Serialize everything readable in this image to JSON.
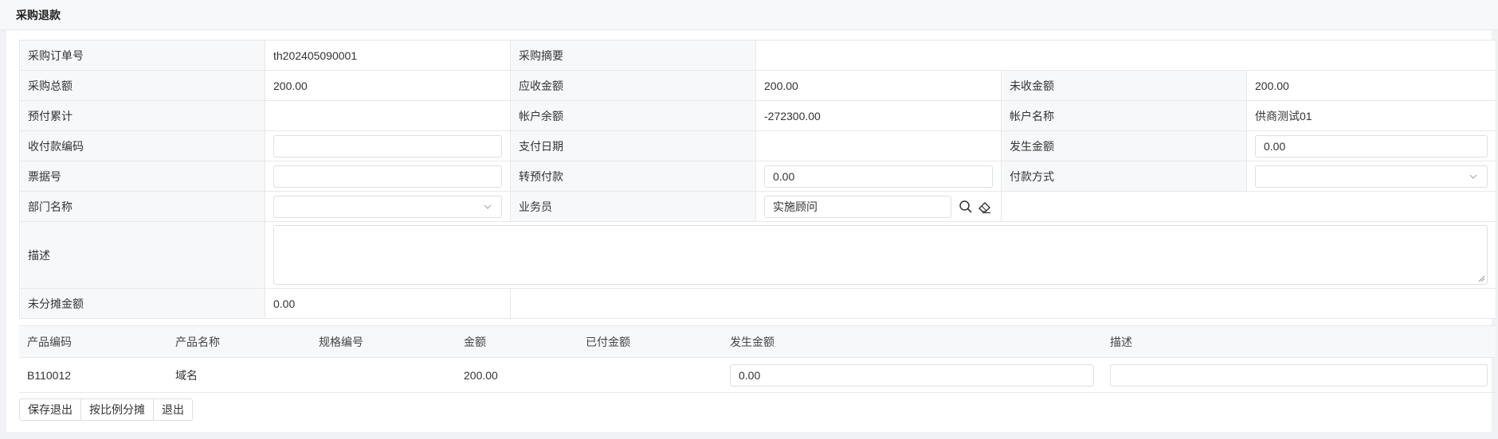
{
  "page": {
    "title": "采购退款"
  },
  "form": {
    "order_no": {
      "label": "采购订单号",
      "value": "th202405090001"
    },
    "summary": {
      "label": "采购摘要",
      "value": ""
    },
    "total": {
      "label": "采购总额",
      "value": "200.00"
    },
    "receivable": {
      "label": "应收金额",
      "value": "200.00"
    },
    "uncollected": {
      "label": "未收金额",
      "value": "200.00"
    },
    "prepaid": {
      "label": "预付累计",
      "value": ""
    },
    "balance": {
      "label": "帐户余额",
      "value": "-272300.00"
    },
    "account": {
      "label": "帐户名称",
      "value": "供商测试01"
    },
    "payment_code": {
      "label": "收付款编码",
      "value": ""
    },
    "pay_date": {
      "label": "支付日期",
      "value": ""
    },
    "amount": {
      "label": "发生金额",
      "value": "0.00"
    },
    "bill_no": {
      "label": "票据号",
      "value": ""
    },
    "transfer_prepay": {
      "label": "转预付款",
      "value": "0.00"
    },
    "pay_method": {
      "label": "付款方式",
      "value": ""
    },
    "dept": {
      "label": "部门名称",
      "value": ""
    },
    "staff": {
      "label": "业务员",
      "value": "实施顾问"
    },
    "desc": {
      "label": "描述",
      "value": ""
    },
    "unallocated": {
      "label": "未分摊金额",
      "value": "0.00"
    }
  },
  "products": {
    "headers": [
      "产品编码",
      "产品名称",
      "规格编号",
      "金额",
      "已付金额",
      "发生金额",
      "描述"
    ],
    "rows": [
      {
        "code": "B110012",
        "name": "域名",
        "spec": "",
        "amount": "200.00",
        "paid": "",
        "occur": "0.00",
        "desc": ""
      }
    ]
  },
  "buttons": {
    "save_exit": "保存退出",
    "allocate": "按比例分摊",
    "exit": "退出"
  }
}
